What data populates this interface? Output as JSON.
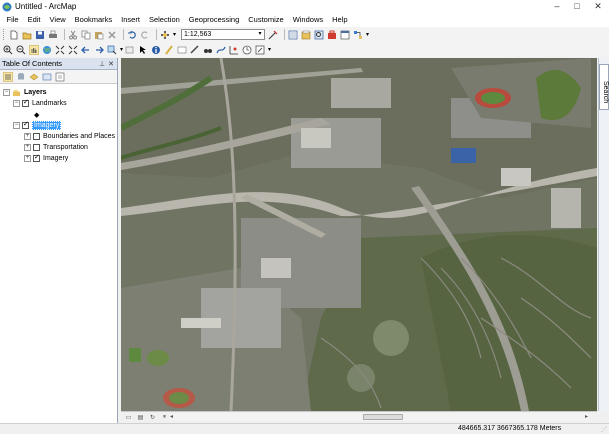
{
  "window": {
    "title": "Untitled - ArcMap"
  },
  "menu": [
    "File",
    "Edit",
    "View",
    "Bookmarks",
    "Insert",
    "Selection",
    "Geoprocessing",
    "Customize",
    "Windows",
    "Help"
  ],
  "toolbar": {
    "scale_value": "1:12,563"
  },
  "toc": {
    "title": "Table Of Contents",
    "root": "Layers",
    "layers": [
      {
        "label": "Landmarks",
        "checked": true,
        "expanded": true
      },
      {
        "label": "Imagery",
        "checked": true,
        "expanded": true,
        "selected": true
      },
      {
        "label": "Boundaries and Places",
        "checked": false,
        "expanded": false
      },
      {
        "label": "Transportation",
        "checked": false,
        "expanded": false
      },
      {
        "label": "Imagery",
        "checked": true,
        "expanded": false
      }
    ]
  },
  "side_panel": {
    "search_label": "Search"
  },
  "status": {
    "coordinates": "484665.317  3667365.178 Meters"
  },
  "colors": {
    "selection": "#3399ff",
    "toc_header": "#d9e2ee"
  }
}
